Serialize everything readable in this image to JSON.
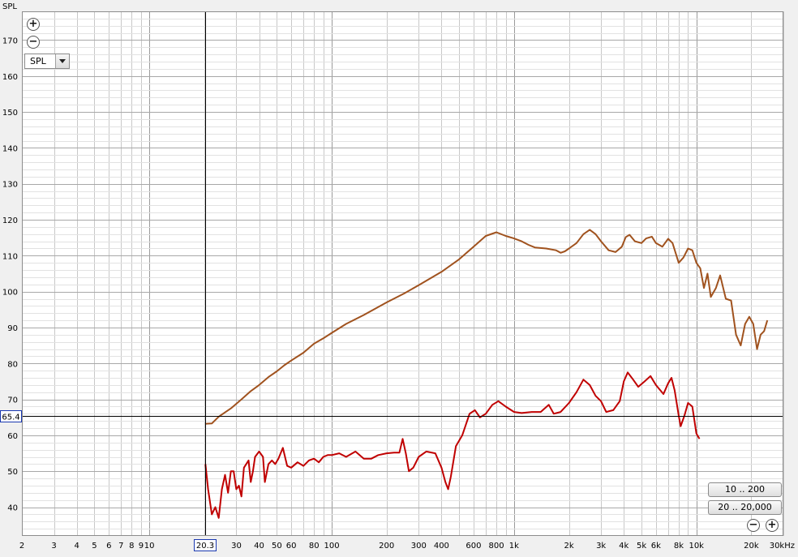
{
  "chart_data": {
    "type": "line",
    "title": "",
    "xlabel": "",
    "ylabel": "SPL",
    "x_unit": "kHz",
    "x_scale": "log",
    "xlim": [
      2,
      30000
    ],
    "ylim": [
      32,
      178
    ],
    "grid": true,
    "x_tick_labels": [
      {
        "value": 2,
        "label": "2"
      },
      {
        "value": 3,
        "label": "3"
      },
      {
        "value": 4,
        "label": "4"
      },
      {
        "value": 5,
        "label": "5"
      },
      {
        "value": 6,
        "label": "6"
      },
      {
        "value": 7,
        "label": "7"
      },
      {
        "value": 8,
        "label": "8"
      },
      {
        "value": 9,
        "label": "9"
      },
      {
        "value": 10,
        "label": "10"
      },
      {
        "value": 30,
        "label": "30"
      },
      {
        "value": 40,
        "label": "40"
      },
      {
        "value": 50,
        "label": "50"
      },
      {
        "value": 60,
        "label": "60"
      },
      {
        "value": 80,
        "label": "80"
      },
      {
        "value": 100,
        "label": "100"
      },
      {
        "value": 200,
        "label": "200"
      },
      {
        "value": 300,
        "label": "300"
      },
      {
        "value": 400,
        "label": "400"
      },
      {
        "value": 600,
        "label": "600"
      },
      {
        "value": 800,
        "label": "800"
      },
      {
        "value": 1000,
        "label": "1k"
      },
      {
        "value": 2000,
        "label": "2k"
      },
      {
        "value": 3000,
        "label": "3k"
      },
      {
        "value": 4000,
        "label": "4k"
      },
      {
        "value": 5000,
        "label": "5k"
      },
      {
        "value": 6000,
        "label": "6k"
      },
      {
        "value": 8000,
        "label": "8k"
      },
      {
        "value": 10000,
        "label": "10k"
      },
      {
        "value": 20000,
        "label": "20k"
      },
      {
        "value": 30000,
        "label": "30kHz"
      }
    ],
    "y_ticks": [
      40,
      50,
      60,
      70,
      80,
      90,
      100,
      110,
      120,
      130,
      140,
      150,
      160,
      170
    ],
    "cursor": {
      "x": 20.3,
      "y": 65.4,
      "x_label": "20.3",
      "y_label": "65.4"
    },
    "series": [
      {
        "color": "#a0521e",
        "points": [
          [
            20.3,
            63.2
          ],
          [
            22,
            63.3
          ],
          [
            24,
            65.2
          ],
          [
            28,
            67.5
          ],
          [
            32,
            70
          ],
          [
            36,
            72.3
          ],
          [
            40,
            74
          ],
          [
            45,
            76.2
          ],
          [
            50,
            77.8
          ],
          [
            55,
            79.5
          ],
          [
            60,
            80.8
          ],
          [
            70,
            83
          ],
          [
            80,
            85.5
          ],
          [
            90,
            87
          ],
          [
            100,
            88.5
          ],
          [
            120,
            91
          ],
          [
            150,
            93.5
          ],
          [
            200,
            97
          ],
          [
            250,
            99.5
          ],
          [
            300,
            101.8
          ],
          [
            400,
            105.5
          ],
          [
            500,
            109
          ],
          [
            600,
            112.5
          ],
          [
            700,
            115.5
          ],
          [
            800,
            116.5
          ],
          [
            900,
            115.5
          ],
          [
            1000,
            114.8
          ],
          [
            1100,
            114
          ],
          [
            1200,
            113
          ],
          [
            1300,
            112.3
          ],
          [
            1500,
            112
          ],
          [
            1700,
            111.5
          ],
          [
            1800,
            110.8
          ],
          [
            1900,
            111.2
          ],
          [
            2000,
            112
          ],
          [
            2200,
            113.5
          ],
          [
            2400,
            116
          ],
          [
            2600,
            117.2
          ],
          [
            2800,
            116
          ],
          [
            3000,
            114
          ],
          [
            3300,
            111.5
          ],
          [
            3600,
            111
          ],
          [
            3900,
            112.5
          ],
          [
            4100,
            115.2
          ],
          [
            4300,
            115.8
          ],
          [
            4600,
            114
          ],
          [
            5000,
            113.5
          ],
          [
            5300,
            114.8
          ],
          [
            5700,
            115.3
          ],
          [
            6000,
            113.5
          ],
          [
            6500,
            112.5
          ],
          [
            7000,
            114.7
          ],
          [
            7400,
            113.5
          ],
          [
            8000,
            108
          ],
          [
            8500,
            109.5
          ],
          [
            9000,
            112
          ],
          [
            9500,
            111.5
          ],
          [
            10000,
            108
          ],
          [
            10500,
            106.5
          ],
          [
            11000,
            101
          ],
          [
            11500,
            105
          ],
          [
            12000,
            98.5
          ],
          [
            12800,
            101
          ],
          [
            13500,
            104.5
          ],
          [
            14500,
            98
          ],
          [
            15500,
            97.5
          ],
          [
            16500,
            88
          ],
          [
            17500,
            85
          ],
          [
            18500,
            91
          ],
          [
            19500,
            93
          ],
          [
            20500,
            91
          ],
          [
            21500,
            84
          ],
          [
            22500,
            88
          ],
          [
            23500,
            89
          ],
          [
            24500,
            92
          ]
        ]
      },
      {
        "color": "#c00000",
        "points": [
          [
            20.3,
            52
          ],
          [
            21,
            45
          ],
          [
            22,
            38
          ],
          [
            23,
            40
          ],
          [
            24,
            37
          ],
          [
            25,
            45
          ],
          [
            26,
            49
          ],
          [
            27,
            44
          ],
          [
            28,
            50
          ],
          [
            29,
            50
          ],
          [
            30,
            45
          ],
          [
            31,
            46
          ],
          [
            32,
            43
          ],
          [
            33,
            51
          ],
          [
            35,
            53
          ],
          [
            36,
            47
          ],
          [
            37,
            50
          ],
          [
            38,
            54
          ],
          [
            40,
            55.5
          ],
          [
            42,
            54
          ],
          [
            43,
            47
          ],
          [
            45,
            52
          ],
          [
            47,
            53
          ],
          [
            49,
            52
          ],
          [
            51,
            53.5
          ],
          [
            54,
            56.5
          ],
          [
            57,
            51.5
          ],
          [
            60,
            51
          ],
          [
            65,
            52.5
          ],
          [
            70,
            51.5
          ],
          [
            75,
            53
          ],
          [
            80,
            53.5
          ],
          [
            85,
            52.5
          ],
          [
            90,
            54
          ],
          [
            95,
            54.5
          ],
          [
            100,
            54.5
          ],
          [
            110,
            55
          ],
          [
            120,
            54
          ],
          [
            135,
            55.5
          ],
          [
            150,
            53.5
          ],
          [
            165,
            53.5
          ],
          [
            180,
            54.5
          ],
          [
            200,
            55
          ],
          [
            220,
            55.2
          ],
          [
            235,
            55.2
          ],
          [
            245,
            59
          ],
          [
            255,
            55
          ],
          [
            265,
            50
          ],
          [
            280,
            51
          ],
          [
            300,
            54
          ],
          [
            330,
            55.5
          ],
          [
            370,
            55
          ],
          [
            400,
            51
          ],
          [
            420,
            47
          ],
          [
            435,
            45
          ],
          [
            450,
            48.5
          ],
          [
            480,
            57
          ],
          [
            520,
            60
          ],
          [
            570,
            66
          ],
          [
            610,
            67
          ],
          [
            650,
            65
          ],
          [
            700,
            66
          ],
          [
            760,
            68.5
          ],
          [
            820,
            69.5
          ],
          [
            900,
            68
          ],
          [
            1000,
            66.5
          ],
          [
            1100,
            66.2
          ],
          [
            1250,
            66.5
          ],
          [
            1400,
            66.5
          ],
          [
            1550,
            68.5
          ],
          [
            1650,
            66
          ],
          [
            1800,
            66.5
          ],
          [
            2000,
            69
          ],
          [
            2200,
            72
          ],
          [
            2400,
            75.5
          ],
          [
            2600,
            74
          ],
          [
            2800,
            71
          ],
          [
            3000,
            69.5
          ],
          [
            3200,
            66.5
          ],
          [
            3500,
            67
          ],
          [
            3800,
            69.5
          ],
          [
            4000,
            75
          ],
          [
            4200,
            77.5
          ],
          [
            4500,
            75.5
          ],
          [
            4800,
            73.5
          ],
          [
            5200,
            75
          ],
          [
            5600,
            76.5
          ],
          [
            6000,
            74
          ],
          [
            6600,
            71.5
          ],
          [
            7000,
            74.5
          ],
          [
            7300,
            76
          ],
          [
            7600,
            72.5
          ],
          [
            8000,
            65.5
          ],
          [
            8200,
            62.5
          ],
          [
            8600,
            65.5
          ],
          [
            9000,
            69
          ],
          [
            9500,
            68
          ],
          [
            10000,
            60.5
          ],
          [
            10400,
            59
          ]
        ]
      }
    ]
  },
  "toolbar": {
    "zoom_in_icon": "plus-circle-icon",
    "zoom_out_icon": "minus-circle-icon",
    "zoom_in_glyph": "+",
    "zoom_out_glyph": "−"
  },
  "selector": {
    "value": "SPL"
  },
  "range_buttons": {
    "range_1": "10 .. 200",
    "range_2": "20 .. 20,000"
  },
  "colors": {
    "background": "#ffffff",
    "grid": "#c8c8c8",
    "frame": "#f0f0f0",
    "cursor": "#000000",
    "cursor_label": "#1a38b0"
  }
}
